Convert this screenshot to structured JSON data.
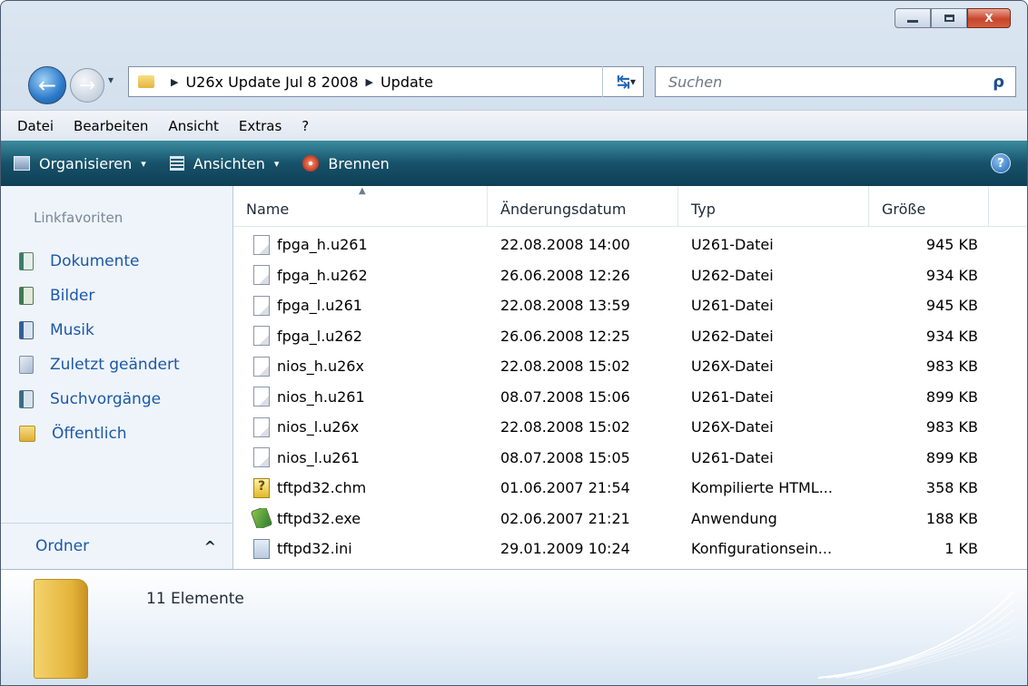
{
  "window": {
    "caption": {
      "minimize": "",
      "maximize": "",
      "close": "X"
    }
  },
  "nav": {
    "back_glyph": "←",
    "forward_glyph": "→",
    "history_glyph": "▾",
    "breadcrumb": [
      "U26x Update Jul 8 2008",
      "Update"
    ],
    "crumb_separator": "▶",
    "address_dropdown_glyph": "▾",
    "refresh_glyph": "↹",
    "search_placeholder": "Suchen",
    "search_glyph": "ρ"
  },
  "menu": [
    {
      "label": "Datei"
    },
    {
      "label": "Bearbeiten"
    },
    {
      "label": "Ansicht"
    },
    {
      "label": "Extras"
    },
    {
      "label": "?"
    }
  ],
  "toolbar": {
    "organize": "Organisieren",
    "views": "Ansichten",
    "burn": "Brennen",
    "caret": "▾",
    "help": "?"
  },
  "navpane": {
    "header": "Linkfavoriten",
    "items": [
      {
        "label": "Dokumente",
        "icon": "documents-icon"
      },
      {
        "label": "Bilder",
        "icon": "pictures-icon"
      },
      {
        "label": "Musik",
        "icon": "music-icon"
      },
      {
        "label": "Zuletzt geändert",
        "icon": "recent-icon"
      },
      {
        "label": "Suchvorgänge",
        "icon": "searches-icon"
      },
      {
        "label": "Öffentlich",
        "icon": "public-folder-icon"
      }
    ],
    "folders_label": "Ordner",
    "folders_chevron": "^"
  },
  "filelist": {
    "columns": {
      "name": "Name",
      "date": "Änderungsdatum",
      "type": "Typ",
      "size": "Größe"
    },
    "sort_glyph": "▲",
    "rows": [
      {
        "name": "fpga_h.u261",
        "date": "22.08.2008 14:00",
        "type": "U261-Datei",
        "size": "945 KB",
        "icon": "blank-file-icon"
      },
      {
        "name": "fpga_h.u262",
        "date": "26.06.2008 12:26",
        "type": "U262-Datei",
        "size": "934 KB",
        "icon": "blank-file-icon"
      },
      {
        "name": "fpga_l.u261",
        "date": "22.08.2008 13:59",
        "type": "U261-Datei",
        "size": "945 KB",
        "icon": "blank-file-icon"
      },
      {
        "name": "fpga_l.u262",
        "date": "26.06.2008 12:25",
        "type": "U262-Datei",
        "size": "934 KB",
        "icon": "blank-file-icon"
      },
      {
        "name": "nios_h.u26x",
        "date": "22.08.2008 15:02",
        "type": "U26X-Datei",
        "size": "983 KB",
        "icon": "blank-file-icon"
      },
      {
        "name": "nios_h.u261",
        "date": "08.07.2008 15:06",
        "type": "U261-Datei",
        "size": "899 KB",
        "icon": "blank-file-icon"
      },
      {
        "name": "nios_l.u26x",
        "date": "22.08.2008 15:02",
        "type": "U26X-Datei",
        "size": "983 KB",
        "icon": "blank-file-icon"
      },
      {
        "name": "nios_l.u261",
        "date": "08.07.2008 15:05",
        "type": "U261-Datei",
        "size": "899 KB",
        "icon": "blank-file-icon"
      },
      {
        "name": "tftpd32.chm",
        "date": "01.06.2007 21:54",
        "type": "Kompilierte HTML...",
        "size": "358 KB",
        "icon": "chm-help-file-icon"
      },
      {
        "name": "tftpd32.exe",
        "date": "02.06.2007 21:21",
        "type": "Anwendung",
        "size": "188 KB",
        "icon": "executable-file-icon"
      },
      {
        "name": "tftpd32.ini",
        "date": "29.01.2009 10:24",
        "type": "Konfigurationsein...",
        "size": "1 KB",
        "icon": "settings-file-icon"
      }
    ]
  },
  "details": {
    "item_count": "11 Elemente"
  }
}
